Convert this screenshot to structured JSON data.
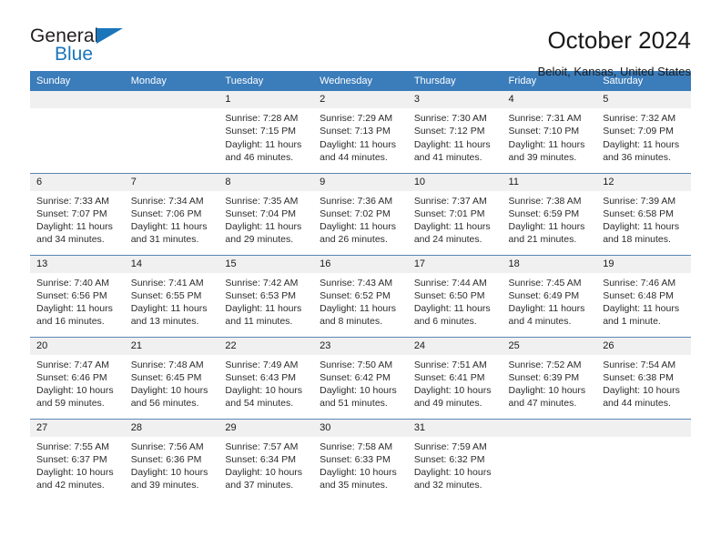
{
  "brand": {
    "name_top": "General",
    "name_bottom": "Blue",
    "logo_color": "#1b75bb",
    "icon": "triangle-logo-icon"
  },
  "header": {
    "title": "October 2024",
    "location": "Beloit, Kansas, United States",
    "accent_color": "#3b7cba"
  },
  "calendar": {
    "weekday_headers": [
      "Sunday",
      "Monday",
      "Tuesday",
      "Wednesday",
      "Thursday",
      "Friday",
      "Saturday"
    ],
    "weeks": [
      [
        {
          "day": "",
          "empty": true
        },
        {
          "day": "",
          "empty": true
        },
        {
          "day": "1",
          "sunrise": "Sunrise: 7:28 AM",
          "sunset": "Sunset: 7:15 PM",
          "daylight": "Daylight: 11 hours and 46 minutes."
        },
        {
          "day": "2",
          "sunrise": "Sunrise: 7:29 AM",
          "sunset": "Sunset: 7:13 PM",
          "daylight": "Daylight: 11 hours and 44 minutes."
        },
        {
          "day": "3",
          "sunrise": "Sunrise: 7:30 AM",
          "sunset": "Sunset: 7:12 PM",
          "daylight": "Daylight: 11 hours and 41 minutes."
        },
        {
          "day": "4",
          "sunrise": "Sunrise: 7:31 AM",
          "sunset": "Sunset: 7:10 PM",
          "daylight": "Daylight: 11 hours and 39 minutes."
        },
        {
          "day": "5",
          "sunrise": "Sunrise: 7:32 AM",
          "sunset": "Sunset: 7:09 PM",
          "daylight": "Daylight: 11 hours and 36 minutes."
        }
      ],
      [
        {
          "day": "6",
          "sunrise": "Sunrise: 7:33 AM",
          "sunset": "Sunset: 7:07 PM",
          "daylight": "Daylight: 11 hours and 34 minutes."
        },
        {
          "day": "7",
          "sunrise": "Sunrise: 7:34 AM",
          "sunset": "Sunset: 7:06 PM",
          "daylight": "Daylight: 11 hours and 31 minutes."
        },
        {
          "day": "8",
          "sunrise": "Sunrise: 7:35 AM",
          "sunset": "Sunset: 7:04 PM",
          "daylight": "Daylight: 11 hours and 29 minutes."
        },
        {
          "day": "9",
          "sunrise": "Sunrise: 7:36 AM",
          "sunset": "Sunset: 7:02 PM",
          "daylight": "Daylight: 11 hours and 26 minutes."
        },
        {
          "day": "10",
          "sunrise": "Sunrise: 7:37 AM",
          "sunset": "Sunset: 7:01 PM",
          "daylight": "Daylight: 11 hours and 24 minutes."
        },
        {
          "day": "11",
          "sunrise": "Sunrise: 7:38 AM",
          "sunset": "Sunset: 6:59 PM",
          "daylight": "Daylight: 11 hours and 21 minutes."
        },
        {
          "day": "12",
          "sunrise": "Sunrise: 7:39 AM",
          "sunset": "Sunset: 6:58 PM",
          "daylight": "Daylight: 11 hours and 18 minutes."
        }
      ],
      [
        {
          "day": "13",
          "sunrise": "Sunrise: 7:40 AM",
          "sunset": "Sunset: 6:56 PM",
          "daylight": "Daylight: 11 hours and 16 minutes."
        },
        {
          "day": "14",
          "sunrise": "Sunrise: 7:41 AM",
          "sunset": "Sunset: 6:55 PM",
          "daylight": "Daylight: 11 hours and 13 minutes."
        },
        {
          "day": "15",
          "sunrise": "Sunrise: 7:42 AM",
          "sunset": "Sunset: 6:53 PM",
          "daylight": "Daylight: 11 hours and 11 minutes."
        },
        {
          "day": "16",
          "sunrise": "Sunrise: 7:43 AM",
          "sunset": "Sunset: 6:52 PM",
          "daylight": "Daylight: 11 hours and 8 minutes."
        },
        {
          "day": "17",
          "sunrise": "Sunrise: 7:44 AM",
          "sunset": "Sunset: 6:50 PM",
          "daylight": "Daylight: 11 hours and 6 minutes."
        },
        {
          "day": "18",
          "sunrise": "Sunrise: 7:45 AM",
          "sunset": "Sunset: 6:49 PM",
          "daylight": "Daylight: 11 hours and 4 minutes."
        },
        {
          "day": "19",
          "sunrise": "Sunrise: 7:46 AM",
          "sunset": "Sunset: 6:48 PM",
          "daylight": "Daylight: 11 hours and 1 minute."
        }
      ],
      [
        {
          "day": "20",
          "sunrise": "Sunrise: 7:47 AM",
          "sunset": "Sunset: 6:46 PM",
          "daylight": "Daylight: 10 hours and 59 minutes."
        },
        {
          "day": "21",
          "sunrise": "Sunrise: 7:48 AM",
          "sunset": "Sunset: 6:45 PM",
          "daylight": "Daylight: 10 hours and 56 minutes."
        },
        {
          "day": "22",
          "sunrise": "Sunrise: 7:49 AM",
          "sunset": "Sunset: 6:43 PM",
          "daylight": "Daylight: 10 hours and 54 minutes."
        },
        {
          "day": "23",
          "sunrise": "Sunrise: 7:50 AM",
          "sunset": "Sunset: 6:42 PM",
          "daylight": "Daylight: 10 hours and 51 minutes."
        },
        {
          "day": "24",
          "sunrise": "Sunrise: 7:51 AM",
          "sunset": "Sunset: 6:41 PM",
          "daylight": "Daylight: 10 hours and 49 minutes."
        },
        {
          "day": "25",
          "sunrise": "Sunrise: 7:52 AM",
          "sunset": "Sunset: 6:39 PM",
          "daylight": "Daylight: 10 hours and 47 minutes."
        },
        {
          "day": "26",
          "sunrise": "Sunrise: 7:54 AM",
          "sunset": "Sunset: 6:38 PM",
          "daylight": "Daylight: 10 hours and 44 minutes."
        }
      ],
      [
        {
          "day": "27",
          "sunrise": "Sunrise: 7:55 AM",
          "sunset": "Sunset: 6:37 PM",
          "daylight": "Daylight: 10 hours and 42 minutes."
        },
        {
          "day": "28",
          "sunrise": "Sunrise: 7:56 AM",
          "sunset": "Sunset: 6:36 PM",
          "daylight": "Daylight: 10 hours and 39 minutes."
        },
        {
          "day": "29",
          "sunrise": "Sunrise: 7:57 AM",
          "sunset": "Sunset: 6:34 PM",
          "daylight": "Daylight: 10 hours and 37 minutes."
        },
        {
          "day": "30",
          "sunrise": "Sunrise: 7:58 AM",
          "sunset": "Sunset: 6:33 PM",
          "daylight": "Daylight: 10 hours and 35 minutes."
        },
        {
          "day": "31",
          "sunrise": "Sunrise: 7:59 AM",
          "sunset": "Sunset: 6:32 PM",
          "daylight": "Daylight: 10 hours and 32 minutes."
        },
        {
          "day": "",
          "empty": true
        },
        {
          "day": "",
          "empty": true
        }
      ]
    ]
  }
}
